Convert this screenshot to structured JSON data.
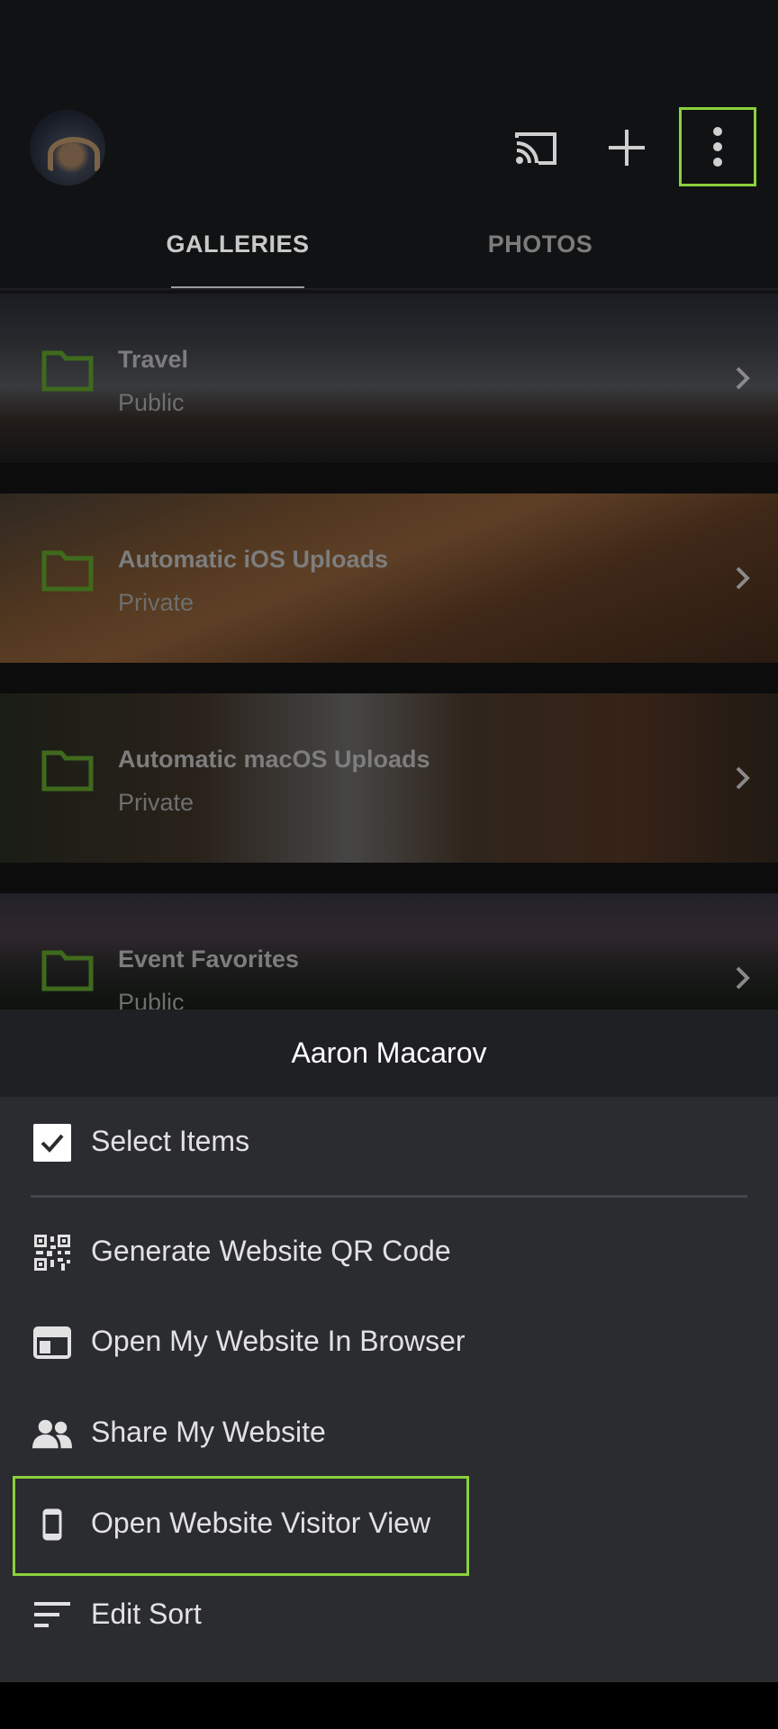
{
  "header": {
    "actions": {
      "cast_icon": "cast-icon",
      "add_icon": "plus-icon",
      "more_icon": "more-vert-icon"
    },
    "tabs": [
      {
        "label": "GALLERIES",
        "active": true
      },
      {
        "label": "PHOTOS",
        "active": false
      }
    ]
  },
  "galleries": [
    {
      "title": "Travel",
      "visibility": "Public"
    },
    {
      "title": "Automatic iOS Uploads",
      "visibility": "Private"
    },
    {
      "title": "Automatic macOS Uploads",
      "visibility": "Private"
    },
    {
      "title": "Event Favorites",
      "visibility": "Public"
    }
  ],
  "menu": {
    "header": "Aaron Macarov",
    "items": [
      {
        "label": "Select Items",
        "icon": "checkbox-icon"
      },
      {
        "label": "Generate Website QR Code",
        "icon": "qr-code-icon"
      },
      {
        "label": "Open My Website In Browser",
        "icon": "browser-window-icon"
      },
      {
        "label": "Share My Website",
        "icon": "people-icon"
      },
      {
        "label": "Open Website Visitor View",
        "icon": "phone-icon"
      },
      {
        "label": "Edit Sort",
        "icon": "sort-icon"
      }
    ]
  },
  "colors": {
    "highlight": "#8ad13b",
    "folder": "#3f6a1d",
    "sheet_bg": "#2b2c30"
  }
}
